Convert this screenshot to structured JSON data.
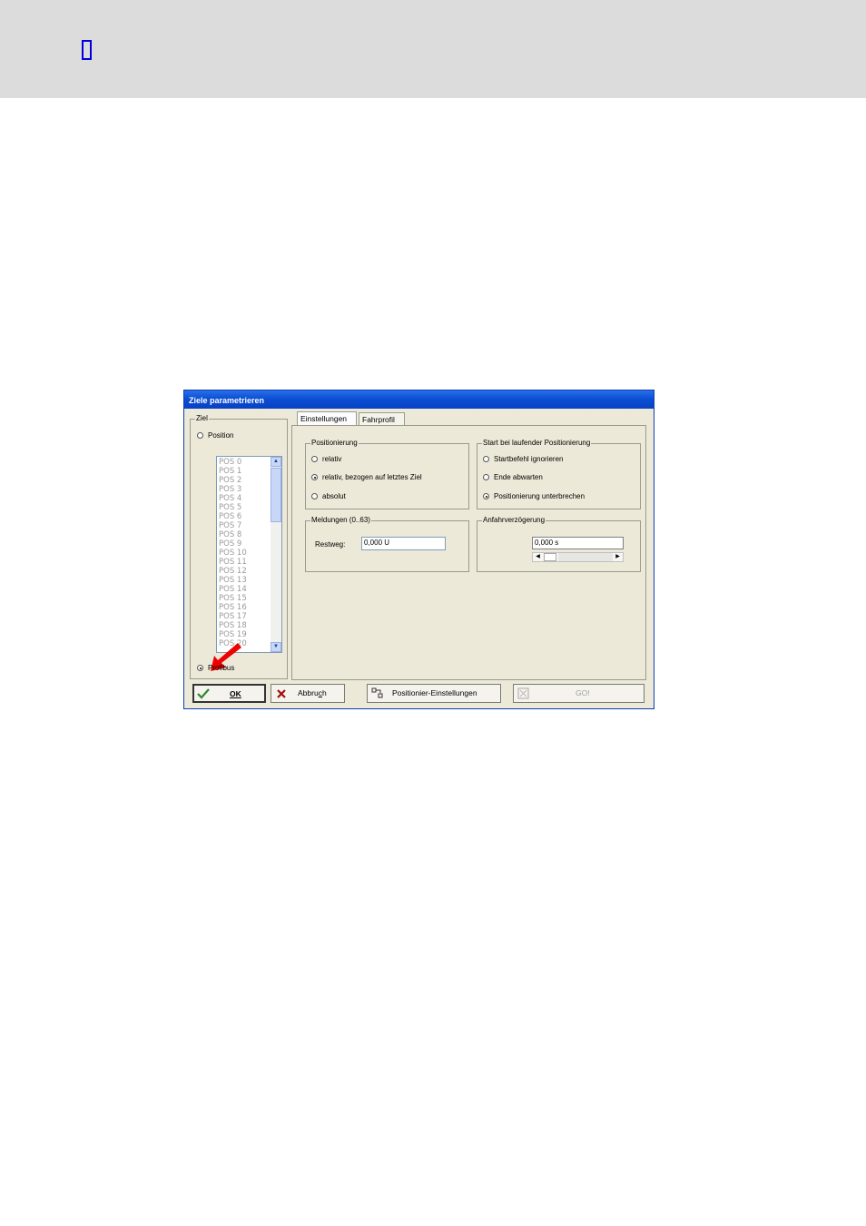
{
  "page": {
    "header_glyph": "▯"
  },
  "dialog": {
    "title": "Ziele parametrieren",
    "ziel": {
      "label": "Ziel",
      "position_label": "Position",
      "profibus_label": "Profibus",
      "selected": "Profibus",
      "list_items": [
        "POS 0",
        "POS 1",
        "POS 2",
        "POS 3",
        "POS 4",
        "POS 5",
        "POS 6",
        "POS 7",
        "POS 8",
        "POS 9",
        "POS 10",
        "POS 11",
        "POS 12",
        "POS 13",
        "POS 14",
        "POS 15",
        "POS 16",
        "POS 17",
        "POS 18",
        "POS 19",
        "POS 20"
      ]
    },
    "tabs": [
      {
        "label": "Einstellungen",
        "active": true
      },
      {
        "label": "Fahrprofil",
        "active": false
      }
    ],
    "positionierung": {
      "label": "Positionierung",
      "options": [
        "relativ",
        "relativ, bezogen auf letztes Ziel",
        "absolut"
      ],
      "selected": "relativ, bezogen auf letztes Ziel"
    },
    "start": {
      "label": "Start bei laufender Positionierung",
      "options": [
        "Startbefehl ignorieren",
        "Ende abwarten",
        "Positionierung unterbrechen"
      ],
      "selected": "Positionierung unterbrechen"
    },
    "meldungen": {
      "label": "Meldungen (0..63)",
      "restweg_label": "Restweg:",
      "restweg_value": "0,000  U"
    },
    "anfahr": {
      "label": "Anfahrverzögerung",
      "value": "0,000 s"
    },
    "buttons": {
      "ok": "OK",
      "abbruch_pre": "Abbru",
      "abbruch_u": "c",
      "abbruch_post": "h",
      "positionier": "Positionier-Einstellungen",
      "go": "GO!"
    },
    "colors": {
      "titlebar": "#0b4fd4",
      "dialog_bg": "#ece9d8",
      "arrow": "#ee0000"
    }
  }
}
